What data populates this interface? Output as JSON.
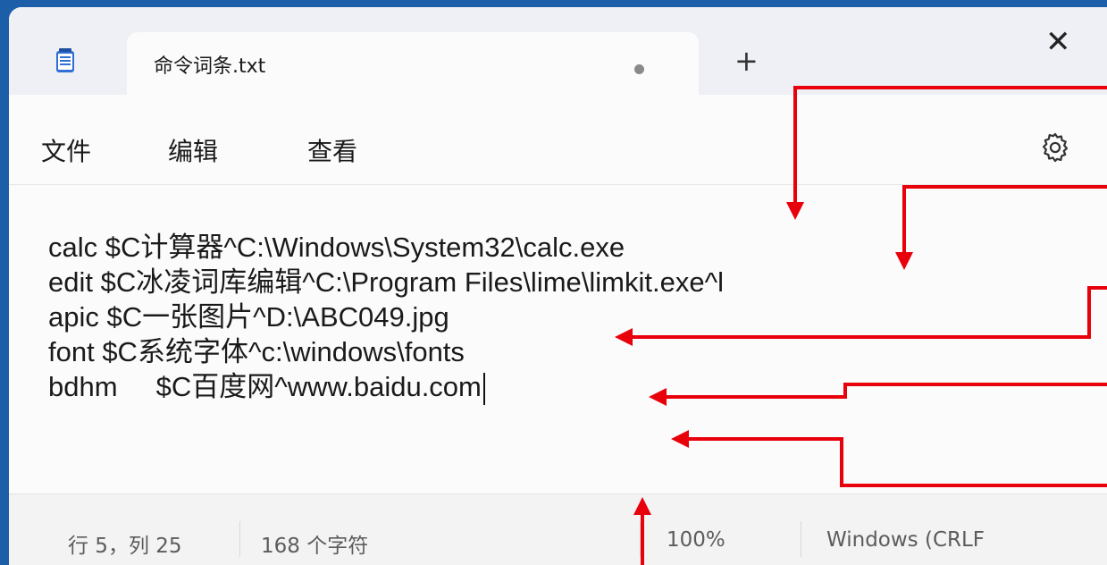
{
  "tab": {
    "title": "命令词条.txt"
  },
  "menu": {
    "file": "文件",
    "edit": "编辑",
    "view": "查看"
  },
  "editor": {
    "lines": [
      "calc $C计算器^C:\\Windows\\System32\\calc.exe",
      "edit $C冰凌词库编辑^C:\\Program Files\\lime\\limkit.exe^l",
      "apic $C一张图片^D:\\ABC049.jpg",
      "font $C系统字体^c:\\windows\\fonts",
      "bdhm     $C百度网^www.baidu.com"
    ]
  },
  "status": {
    "position": "行 5，列 25",
    "char_count": "168 个字符",
    "zoom": "100%",
    "line_ending": "Windows (CRLF"
  },
  "icons": {
    "new_tab": "+",
    "close": "✕",
    "settings": "gear-icon",
    "app": "notepad-icon"
  },
  "colors": {
    "background": "#1c5fa8",
    "annotation_arrow": "#e8000b"
  }
}
